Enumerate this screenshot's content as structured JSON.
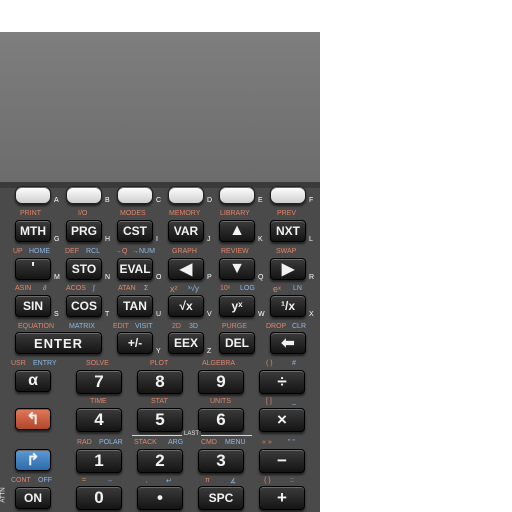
{
  "menu_keys": [
    "A",
    "B",
    "C",
    "D",
    "E",
    "F"
  ],
  "row_mth": {
    "labels": [
      "PRINT",
      "I/O",
      "MODES",
      "MEMORY",
      "LIBRARY",
      "PREV"
    ],
    "keys": [
      "MTH",
      "PRG",
      "CST",
      "VAR",
      "▲",
      "NXT"
    ],
    "letters": [
      "G",
      "H",
      "I",
      "J",
      "K",
      "L"
    ]
  },
  "row_quote": {
    "left": [
      "UP",
      "DEF",
      "→Q",
      "GRAPH",
      "REVIEW",
      "SWAP"
    ],
    "right": [
      "HOME",
      "RCL",
      "→NUM",
      "",
      "",
      ""
    ],
    "keys": [
      "'",
      "STO",
      "EVAL",
      "◀",
      "▼",
      "▶"
    ],
    "letters": [
      "M",
      "N",
      "O",
      "P",
      "Q",
      "R"
    ]
  },
  "row_sin": {
    "left": [
      "ASIN",
      "ACOS",
      "ATAN",
      "x²",
      "10ˣ",
      "eˣ"
    ],
    "right": [
      "∂",
      "∫",
      "Σ",
      "ˣ√y",
      "LOG",
      "LN"
    ],
    "keys": [
      "SIN",
      "COS",
      "TAN",
      "√x",
      "yˣ",
      "¹/x"
    ],
    "letters": [
      "S",
      "T",
      "U",
      "V",
      "W",
      "X"
    ]
  },
  "row_enter": {
    "l1": [
      "EQUATION",
      "EDIT",
      "2D",
      "PURGE",
      "DROP"
    ],
    "l2": [
      "MATRIX",
      "VISIT",
      "3D",
      "",
      "CLR"
    ],
    "keys": [
      "ENTER",
      "+/-",
      "EEX",
      "DEL",
      "⬅"
    ],
    "letters": [
      "Y",
      "Z"
    ]
  },
  "row_7": {
    "left": [
      "USR",
      "SOLVE",
      "PLOT",
      "ALGEBRA",
      "( )"
    ],
    "right": [
      "ENTRY",
      "",
      "",
      "",
      "#"
    ],
    "keys": [
      "α",
      "7",
      "8",
      "9",
      "÷"
    ]
  },
  "row_4": {
    "labels": [
      "TIME",
      "STAT",
      "UNITS",
      "[ ]"
    ],
    "right": [
      "_"
    ],
    "keys": [
      "↰",
      "4",
      "5",
      "6",
      "×"
    ]
  },
  "row_1": {
    "left": [
      "RAD",
      "STACK",
      "CMD",
      "« »"
    ],
    "right": [
      "POLAR",
      "ARG",
      "MENU",
      "\" \""
    ],
    "last": "LAST",
    "keys": [
      "↱",
      "1",
      "2",
      "3",
      "−"
    ]
  },
  "row_0": {
    "attn": "ATTN",
    "left": [
      "CONT",
      "=",
      "‚",
      "π",
      "{ }"
    ],
    "right": [
      "OFF",
      "→",
      "↵",
      "∡",
      "::"
    ],
    "keys": [
      "ON",
      "0",
      "•",
      "SPC",
      "+"
    ]
  }
}
